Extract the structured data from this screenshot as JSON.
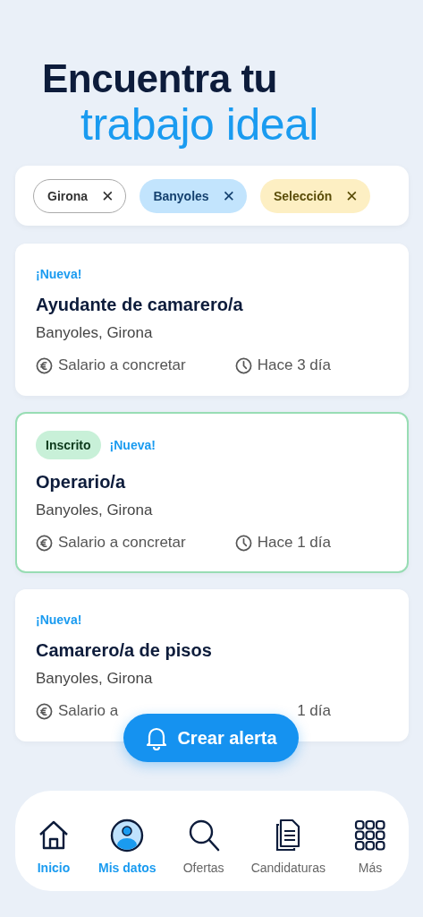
{
  "heading": {
    "line_1": "Encuentra tu",
    "line_2": "trabajo ideal"
  },
  "filters": [
    {
      "label": "Girona",
      "color": "#ffffff",
      "remove": "✕"
    },
    {
      "label": "Banyoles",
      "color": "#c2e4fd",
      "remove": "✕"
    },
    {
      "label": "Selección",
      "color": "#fdefc3",
      "remove": "✕"
    }
  ],
  "jobs": [
    {
      "applied": false,
      "badge": "¡Nueva!",
      "title": "Ayudante de camarero/a",
      "location": "Banyoles, Girona",
      "salary": "Salario a concretar",
      "time": "Hace 3 día",
      "time_icon": true
    },
    {
      "applied": true,
      "status": "Inscrito",
      "badge": "¡Nueva!",
      "title": "Operario/a",
      "location": "Banyoles, Girona",
      "salary": "Salario a concretar",
      "time": "Hace 1 día",
      "time_icon": true
    },
    {
      "applied": false,
      "badge": "¡Nueva!",
      "title": "Camarero/a de pisos",
      "location": "Banyoles, Girona",
      "salary": "Salario a",
      "time": "1 día",
      "time_icon": false
    }
  ],
  "alert_button": {
    "label": "Crear alerta"
  },
  "nav": [
    {
      "kind": "home",
      "label": "Inicio",
      "selected": true
    },
    {
      "kind": "profile",
      "label": "Mis datos",
      "selected": true
    },
    {
      "kind": "search",
      "label": "Ofertas",
      "selected": false
    },
    {
      "kind": "documents",
      "label": "Candidaturas",
      "selected": false
    },
    {
      "kind": "grid",
      "label": "Más",
      "selected": false
    }
  ]
}
